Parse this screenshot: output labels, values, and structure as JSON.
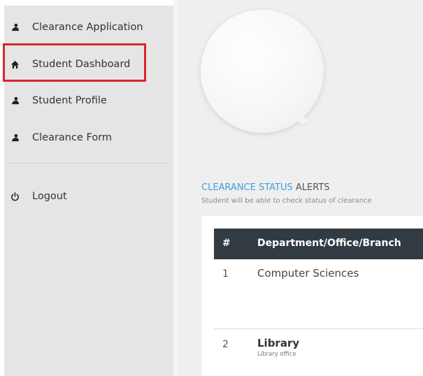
{
  "sidebar": {
    "items": [
      {
        "label": "Clearance Application",
        "icon": "user-icon"
      },
      {
        "label": "Student Dashboard",
        "icon": "home-icon",
        "active": true
      },
      {
        "label": "Student Profile",
        "icon": "user-icon"
      },
      {
        "label": "Clearance Form",
        "icon": "user-icon"
      }
    ],
    "logout": {
      "label": "Logout",
      "icon": "power-icon"
    }
  },
  "main": {
    "status_title_accent": "CLEARANCE STATUS",
    "status_title_rest": " ALERTS",
    "status_subtitle": "Student will be able to check status of clearance",
    "table": {
      "headers": [
        "#",
        "Department/Office/Branch"
      ],
      "rows": [
        {
          "num": "1",
          "name": "Computer Sciences",
          "sub": ""
        },
        {
          "num": "2",
          "name": "Library",
          "sub": "Library office"
        }
      ]
    }
  },
  "colors": {
    "accent": "#3fa0d8",
    "highlight_border": "#d8262c",
    "table_header": "#333b42",
    "sidebar_bg": "#e5e5e5"
  }
}
